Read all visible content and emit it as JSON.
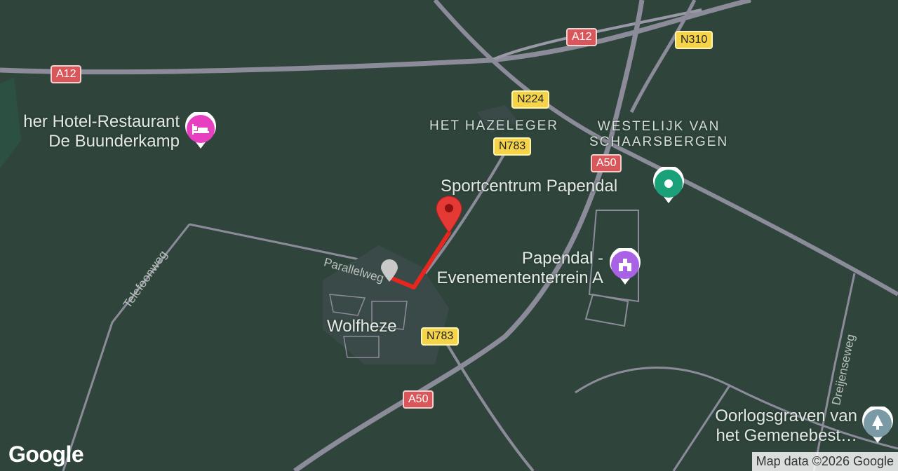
{
  "map": {
    "shields": [
      {
        "name": "a12-shield-left",
        "text": "A12",
        "kind": "a"
      },
      {
        "name": "a12-shield-top",
        "text": "A12",
        "kind": "a"
      },
      {
        "name": "n310-shield",
        "text": "N310",
        "kind": "n"
      },
      {
        "name": "n224-shield",
        "text": "N224",
        "kind": "n"
      },
      {
        "name": "n783-shield-top",
        "text": "N783",
        "kind": "n"
      },
      {
        "name": "a50-shield-top",
        "text": "A50",
        "kind": "a"
      },
      {
        "name": "n783-shield-bottom",
        "text": "N783",
        "kind": "n"
      },
      {
        "name": "a50-shield-bottom",
        "text": "A50",
        "kind": "a"
      }
    ],
    "areas": {
      "het_hazeleger": "HET HAZELEGER",
      "westelijk_line1": "WESTELIJK VAN",
      "westelijk_line2": "SCHAARSBERGEN"
    },
    "place": "Wolfheze",
    "roads": {
      "telefoonweg": "Telefoonweg",
      "parallelweg": "Parallelweg",
      "dreijenseweg": "Dreijenseweg"
    },
    "pois": {
      "hotel_line1": "her Hotel-Restaurant",
      "hotel_line2": "De Buunderkamp",
      "sport": "Sportcentrum Papendal",
      "papendal_line1": "Papendal -",
      "papendal_line2": "Evenemententerrein A",
      "war_line1": "Oorlogsgraven van",
      "war_line2": "het Gemenebest…"
    },
    "colors": {
      "background": "#2f453b",
      "road": "#8a8a99",
      "route": "#e8261e",
      "pin": "#e53935",
      "hotel_marker": "#e63fbf",
      "sport_marker": "#1aa179",
      "papendal_marker": "#a961e6",
      "war_marker": "#7a9aa6"
    },
    "icons": [
      "hotel-bed-icon",
      "sport-dot-icon",
      "monument-icon",
      "cemetery-icon"
    ]
  },
  "footer": {
    "logo": "Google",
    "attribution": "Map data ©2026 Google"
  }
}
